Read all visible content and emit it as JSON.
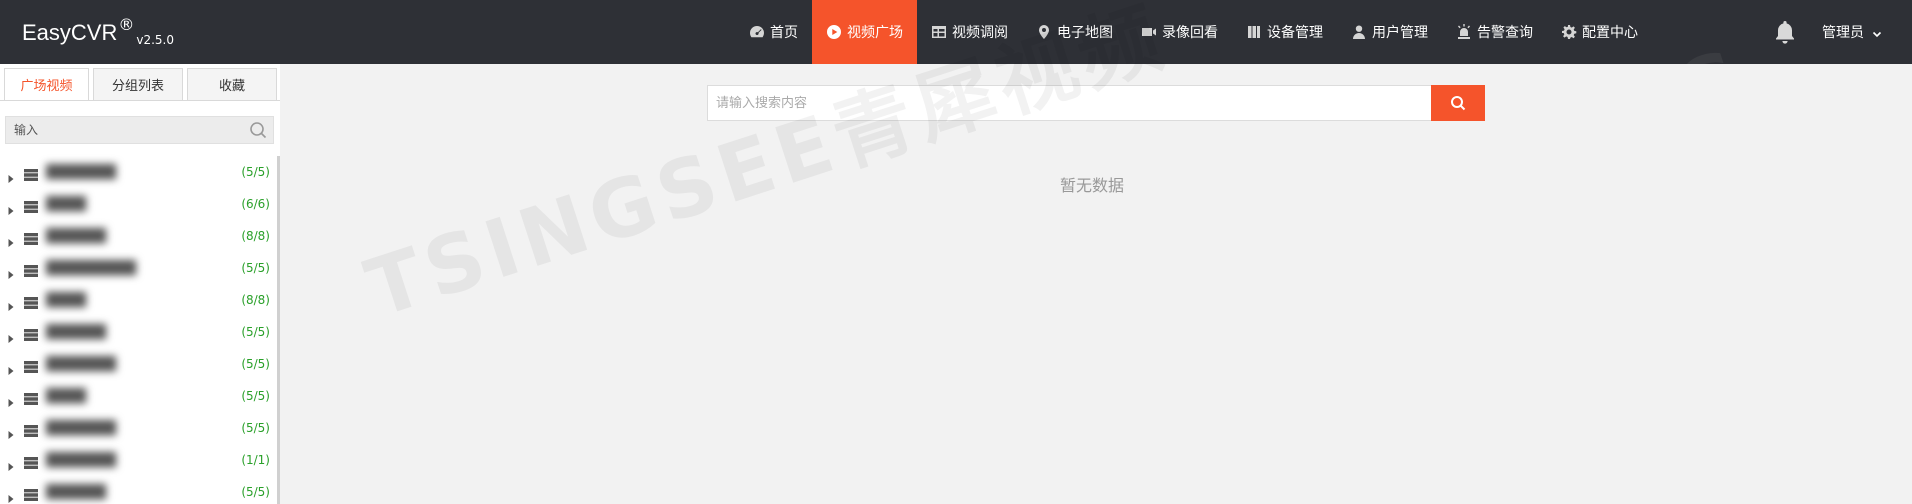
{
  "app": {
    "brand": "EasyCVR",
    "reg": "®",
    "version": "v2.5.0"
  },
  "nav": {
    "items": [
      {
        "label": "首页",
        "icon": "dashboard-icon"
      },
      {
        "label": "视频广场",
        "icon": "play-circle-icon",
        "active": true
      },
      {
        "label": "视频调阅",
        "icon": "grid-icon"
      },
      {
        "label": "电子地图",
        "icon": "map-pin-icon"
      },
      {
        "label": "录像回看",
        "icon": "video-camera-icon"
      },
      {
        "label": "设备管理",
        "icon": "device-icon"
      },
      {
        "label": "用户管理",
        "icon": "user-icon"
      },
      {
        "label": "告警查询",
        "icon": "alarm-icon"
      },
      {
        "label": "配置中心",
        "icon": "gear-icon"
      }
    ],
    "user": "管理员"
  },
  "sidebar": {
    "tabs": [
      {
        "label": "广场视频",
        "active": true
      },
      {
        "label": "分组列表"
      },
      {
        "label": "收藏"
      }
    ],
    "search_placeholder": "输入",
    "tree": [
      {
        "label": "███████",
        "count": "(5/5)"
      },
      {
        "label": "████",
        "count": "(6/6)"
      },
      {
        "label": "██████",
        "count": "(8/8)"
      },
      {
        "label": "█████████",
        "count": "(5/5)"
      },
      {
        "label": "████",
        "count": "(8/8)"
      },
      {
        "label": "██████",
        "count": "(5/5)"
      },
      {
        "label": "███████",
        "count": "(5/5)"
      },
      {
        "label": "████",
        "count": "(5/5)"
      },
      {
        "label": "███████",
        "count": "(5/5)"
      },
      {
        "label": "███████",
        "count": "(1/1)"
      },
      {
        "label": "██████",
        "count": "(5/5)"
      }
    ]
  },
  "main": {
    "search_placeholder": "请输入搜索内容",
    "empty_text": "暂无数据"
  },
  "watermark": {
    "text": "TSINGSEE青犀视频",
    "text2": "TSING"
  },
  "colors": {
    "accent": "#f5542b",
    "topbar": "#2e3036",
    "count": "#2aa02a"
  }
}
